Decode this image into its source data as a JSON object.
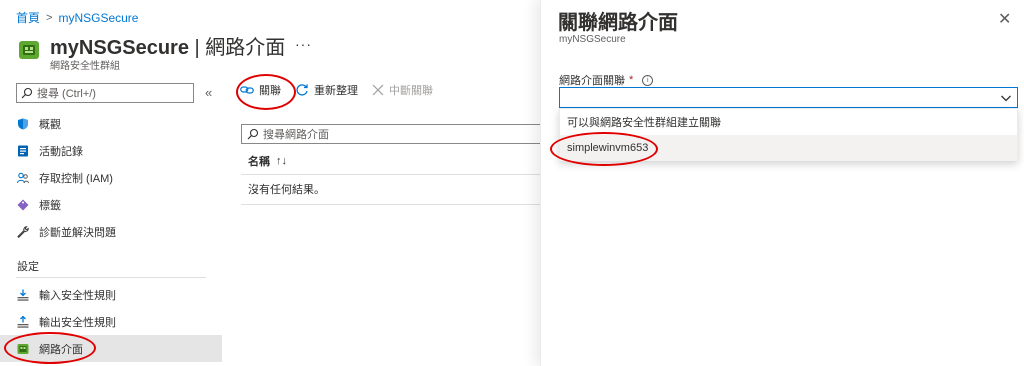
{
  "breadcrumb": {
    "home": "首頁",
    "resource": "myNSGSecure"
  },
  "header": {
    "title_name": "myNSGSecure",
    "title_sep": "|",
    "title_section": "網路介面",
    "more": "···",
    "subtitle": "網路安全性群組"
  },
  "sidebar": {
    "search_placeholder": "搜尋 (Ctrl+/)",
    "collapse": "«",
    "items": [
      {
        "label": "概觀",
        "icon": "shield-icon"
      },
      {
        "label": "活動記錄",
        "icon": "activity-log-icon"
      },
      {
        "label": "存取控制 (IAM)",
        "icon": "people-icon"
      },
      {
        "label": "標籤",
        "icon": "tag-icon"
      },
      {
        "label": "診斷並解決問題",
        "icon": "wrench-icon"
      }
    ],
    "section_label": "設定",
    "settings_items": [
      {
        "label": "輸入安全性規則",
        "icon": "inbound-rules-icon"
      },
      {
        "label": "輸出安全性規則",
        "icon": "outbound-rules-icon"
      },
      {
        "label": "網路介面",
        "icon": "network-interface-icon",
        "active": true
      }
    ]
  },
  "toolbar": {
    "associate": "關聯",
    "refresh": "重新整理",
    "dissociate": "中斷關聯"
  },
  "content": {
    "search_placeholder": "搜尋網路介面",
    "column_name": "名稱",
    "sort_glyph": "↑↓",
    "empty_text": "沒有任何結果。"
  },
  "panel": {
    "title": "關聯網路介面",
    "subtitle": "myNSGSecure",
    "close": "✕",
    "field_label": "網路介面關聯",
    "required_mark": "*",
    "info": "i",
    "select_value": "",
    "dropdown_header": "可以與網路安全性群組建立關聯",
    "dropdown_options": [
      "simplewinvm653"
    ]
  },
  "colors": {
    "accent": "#0078d4",
    "annotation": "#e00000",
    "required": "#a4262c"
  }
}
